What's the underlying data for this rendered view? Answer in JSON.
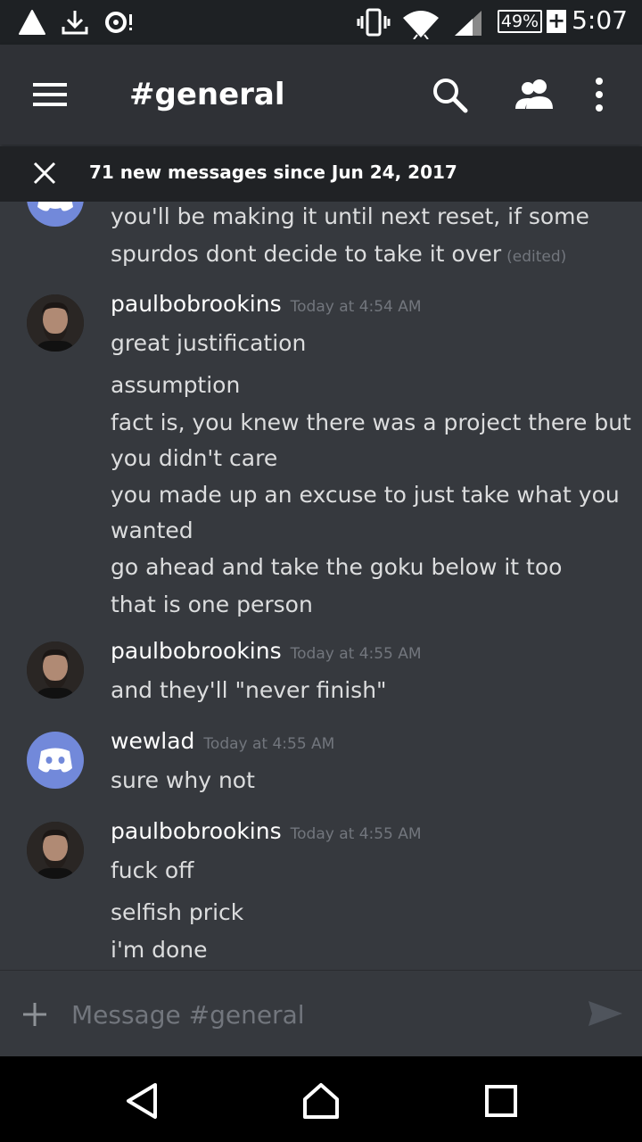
{
  "status_bar": {
    "battery": "49%",
    "battery_plus": "+",
    "time": "5:07",
    "icons": [
      "alert-triangle-icon",
      "download-icon",
      "sync-icon",
      "vibrate-icon",
      "wifi-icon",
      "signal-icon",
      "battery-icon"
    ]
  },
  "app_bar": {
    "title": "#general",
    "icons": [
      "menu-icon",
      "search-icon",
      "members-icon",
      "more-vert-icon"
    ]
  },
  "banner": {
    "text": "71 new messages since Jun 24, 2017"
  },
  "messages": [
    {
      "continued": true,
      "lines": [
        "you'll be making it until next reset, if some",
        "spurdos dont decide to take it over"
      ],
      "edited": "(edited)"
    },
    {
      "author": "paulbobrookins",
      "timestamp": "Today at 4:54 AM",
      "lines": [
        "great justification",
        "assumption",
        "fact is, you knew there was a project there but",
        "you didn't care",
        "you made up an excuse to just take what you",
        "wanted",
        "go ahead and take the goku below it too",
        "that is one person"
      ]
    },
    {
      "author": "paulbobrookins",
      "timestamp": "Today at 4:55 AM",
      "lines": [
        "and they'll \"never finish\""
      ]
    },
    {
      "author": "wewlad",
      "timestamp": "Today at 4:55 AM",
      "lines": [
        "sure why not"
      ]
    },
    {
      "author": "paulbobrookins",
      "timestamp": "Today at 4:55 AM",
      "lines": [
        "fuck off",
        "selfish prick",
        "i'm done"
      ]
    }
  ],
  "composer": {
    "placeholder": "Message #general"
  },
  "colors": {
    "background": "#36393e",
    "appbar": "#2f3136",
    "blurple": "#7289da",
    "timestamp": "#72767d"
  }
}
